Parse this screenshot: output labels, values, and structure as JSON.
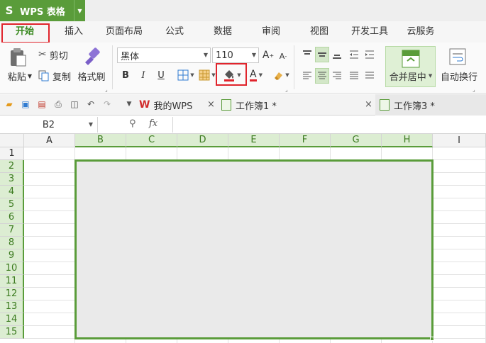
{
  "app": {
    "logo": "S",
    "name": "WPS 表格"
  },
  "menu": {
    "tabs": [
      {
        "label": "开始",
        "active": true
      },
      {
        "label": "插入"
      },
      {
        "label": "页面布局"
      },
      {
        "label": "公式"
      },
      {
        "label": "数据"
      },
      {
        "label": "审阅"
      },
      {
        "label": "视图"
      },
      {
        "label": "开发工具"
      },
      {
        "label": "云服务"
      }
    ]
  },
  "ribbon": {
    "paste": "粘贴",
    "cut": "剪切",
    "copy": "复制",
    "format_painter": "格式刷",
    "font_name": "黑体",
    "font_size": "110",
    "bold": "B",
    "italic": "I",
    "underline": "U",
    "font_color_glyph": "A",
    "grow_font": "A",
    "shrink_font": "A",
    "merge_center": "合并居中",
    "wrap_text": "自动换行"
  },
  "doc_tabs": [
    {
      "label": "我的WPS"
    },
    {
      "label": "工作簿1 *"
    },
    {
      "label": "工作簿3 *",
      "active": true
    }
  ],
  "formula_bar": {
    "name_box": "B2",
    "fx": "fx",
    "value": ""
  },
  "grid": {
    "columns": [
      "A",
      "B",
      "C",
      "D",
      "E",
      "F",
      "G",
      "H",
      "I"
    ],
    "rows": [
      "1",
      "2",
      "3",
      "4",
      "5",
      "6",
      "7",
      "8",
      "9",
      "10",
      "11",
      "12",
      "13",
      "14",
      "15"
    ],
    "selected_columns": [
      "B",
      "C",
      "D",
      "E",
      "F",
      "G",
      "H"
    ],
    "selected_rows": [
      "2",
      "3",
      "4",
      "5",
      "6",
      "7",
      "8",
      "9",
      "10",
      "11",
      "12",
      "13",
      "14",
      "15"
    ]
  },
  "colors": {
    "accent": "#5a9c3a",
    "highlight": "#e0242c",
    "selection_fill": "#eaeaea",
    "fill_color_bar": "#e0242c"
  },
  "icons": {
    "paste": "paste-icon",
    "cut": "scissors-icon",
    "copy": "copy-icon",
    "format_painter": "brush-icon",
    "fill_color": "paint-bucket-icon",
    "border": "border-icon",
    "cell_style": "cell-style-icon",
    "zoom": "zoom-icon",
    "open": "folder-icon",
    "save": "save-icon",
    "print": "print-icon",
    "undo": "undo-icon",
    "redo": "redo-icon"
  }
}
